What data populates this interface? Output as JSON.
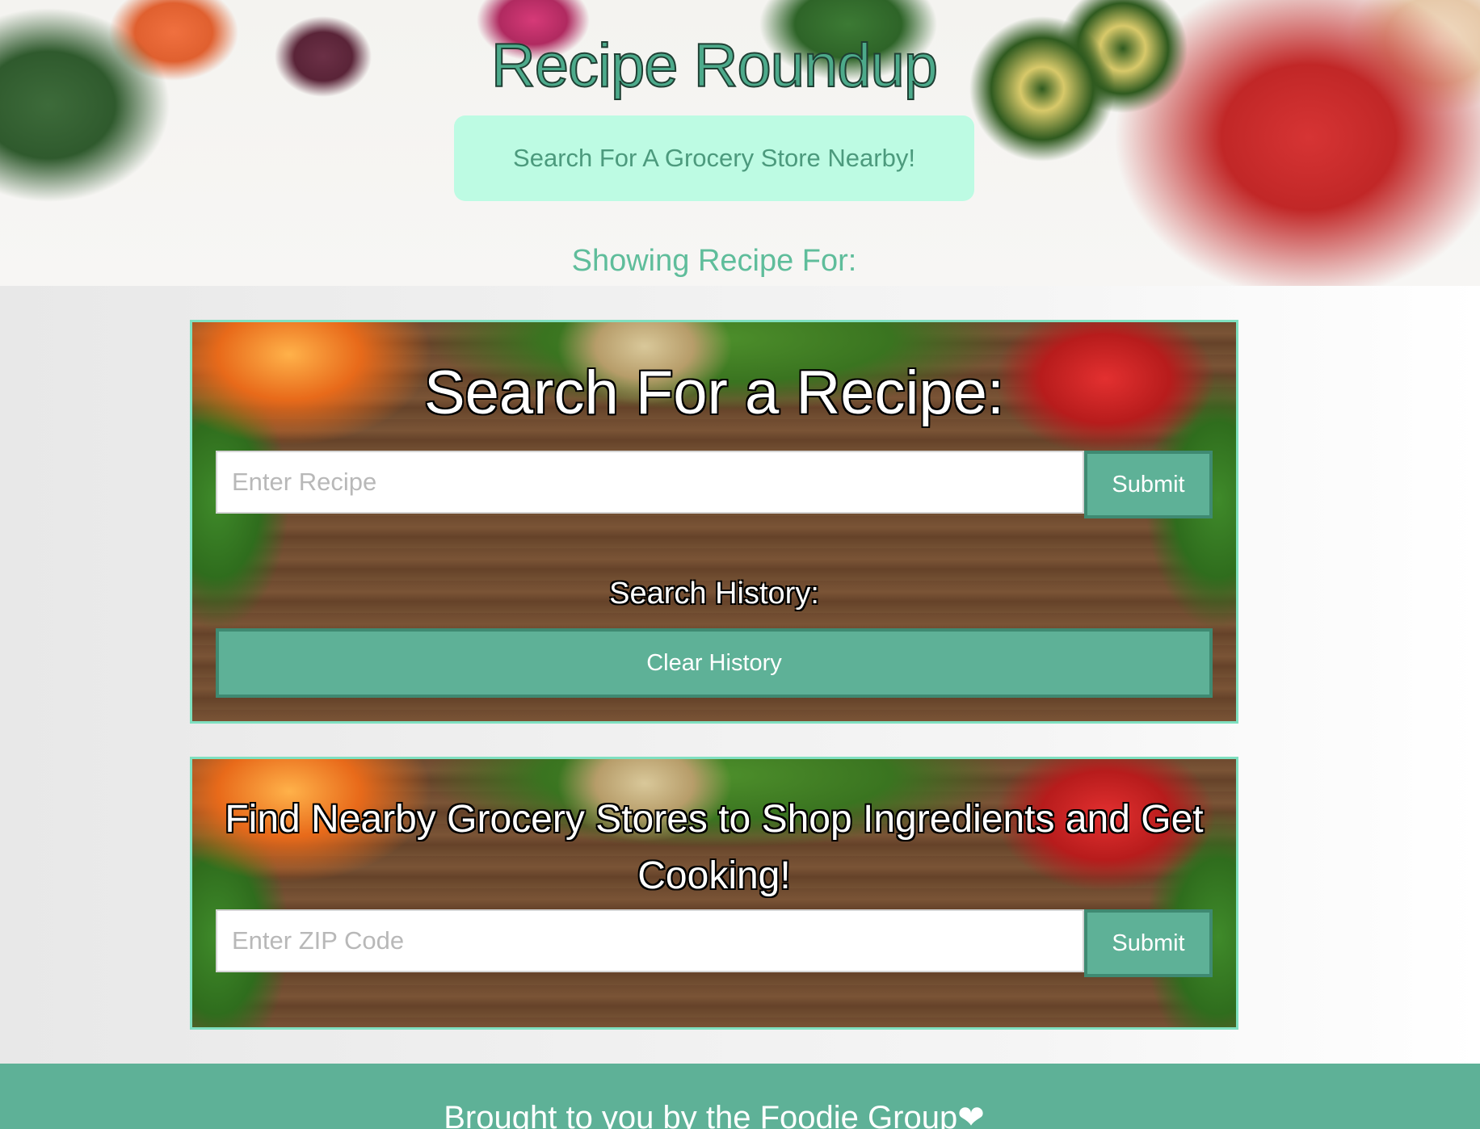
{
  "header": {
    "title": "Recipe Roundup",
    "grocery_button": "Search For A Grocery Store Nearby!",
    "showing_label": "Showing Recipe For:"
  },
  "recipe_card": {
    "heading": "Search For a Recipe:",
    "input_placeholder": "Enter Recipe",
    "input_value": "",
    "submit_label": "Submit",
    "history_label": "Search History:",
    "clear_label": "Clear History"
  },
  "store_card": {
    "heading": "Find Nearby Grocery Stores to Shop Ingredients and Get Cooking!",
    "input_placeholder": "Enter ZIP Code",
    "input_value": "",
    "submit_label": "Submit"
  },
  "footer": {
    "text": "Brought to you by the Foodie Group❤"
  },
  "colors": {
    "accent": "#5eb197",
    "grocery_button_bg": "#bdfbe3",
    "title_fill": "#4daa8b",
    "card_border": "#7fe0c0"
  }
}
